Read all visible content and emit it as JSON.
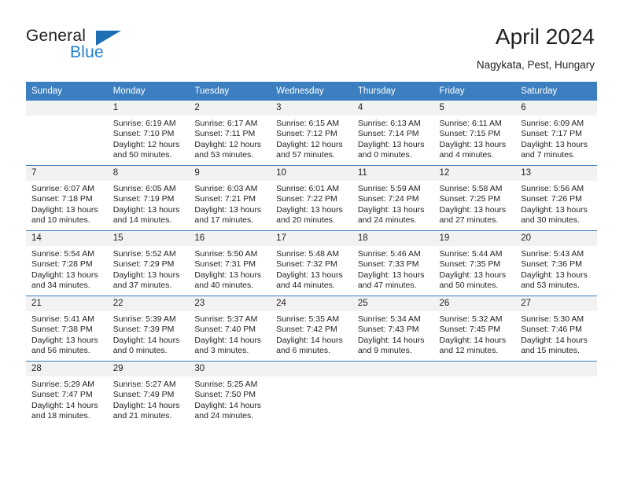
{
  "logo": {
    "word1": "General",
    "word2": "Blue",
    "flag_color": "#1f6fb5",
    "blue_color": "#1f7fd0"
  },
  "header": {
    "month_title": "April 2024",
    "location": "Nagykata, Pest, Hungary"
  },
  "calendar": {
    "header_color": "#3c7fc0",
    "daynum_bg": "#f2f2f2",
    "weekdays": [
      "Sunday",
      "Monday",
      "Tuesday",
      "Wednesday",
      "Thursday",
      "Friday",
      "Saturday"
    ],
    "weeks": [
      [
        {
          "day": "",
          "sunrise": "",
          "sunset": "",
          "daylight1": "",
          "daylight2": ""
        },
        {
          "day": "1",
          "sunrise": "Sunrise: 6:19 AM",
          "sunset": "Sunset: 7:10 PM",
          "daylight1": "Daylight: 12 hours",
          "daylight2": "and 50 minutes."
        },
        {
          "day": "2",
          "sunrise": "Sunrise: 6:17 AM",
          "sunset": "Sunset: 7:11 PM",
          "daylight1": "Daylight: 12 hours",
          "daylight2": "and 53 minutes."
        },
        {
          "day": "3",
          "sunrise": "Sunrise: 6:15 AM",
          "sunset": "Sunset: 7:12 PM",
          "daylight1": "Daylight: 12 hours",
          "daylight2": "and 57 minutes."
        },
        {
          "day": "4",
          "sunrise": "Sunrise: 6:13 AM",
          "sunset": "Sunset: 7:14 PM",
          "daylight1": "Daylight: 13 hours",
          "daylight2": "and 0 minutes."
        },
        {
          "day": "5",
          "sunrise": "Sunrise: 6:11 AM",
          "sunset": "Sunset: 7:15 PM",
          "daylight1": "Daylight: 13 hours",
          "daylight2": "and 4 minutes."
        },
        {
          "day": "6",
          "sunrise": "Sunrise: 6:09 AM",
          "sunset": "Sunset: 7:17 PM",
          "daylight1": "Daylight: 13 hours",
          "daylight2": "and 7 minutes."
        }
      ],
      [
        {
          "day": "7",
          "sunrise": "Sunrise: 6:07 AM",
          "sunset": "Sunset: 7:18 PM",
          "daylight1": "Daylight: 13 hours",
          "daylight2": "and 10 minutes."
        },
        {
          "day": "8",
          "sunrise": "Sunrise: 6:05 AM",
          "sunset": "Sunset: 7:19 PM",
          "daylight1": "Daylight: 13 hours",
          "daylight2": "and 14 minutes."
        },
        {
          "day": "9",
          "sunrise": "Sunrise: 6:03 AM",
          "sunset": "Sunset: 7:21 PM",
          "daylight1": "Daylight: 13 hours",
          "daylight2": "and 17 minutes."
        },
        {
          "day": "10",
          "sunrise": "Sunrise: 6:01 AM",
          "sunset": "Sunset: 7:22 PM",
          "daylight1": "Daylight: 13 hours",
          "daylight2": "and 20 minutes."
        },
        {
          "day": "11",
          "sunrise": "Sunrise: 5:59 AM",
          "sunset": "Sunset: 7:24 PM",
          "daylight1": "Daylight: 13 hours",
          "daylight2": "and 24 minutes."
        },
        {
          "day": "12",
          "sunrise": "Sunrise: 5:58 AM",
          "sunset": "Sunset: 7:25 PM",
          "daylight1": "Daylight: 13 hours",
          "daylight2": "and 27 minutes."
        },
        {
          "day": "13",
          "sunrise": "Sunrise: 5:56 AM",
          "sunset": "Sunset: 7:26 PM",
          "daylight1": "Daylight: 13 hours",
          "daylight2": "and 30 minutes."
        }
      ],
      [
        {
          "day": "14",
          "sunrise": "Sunrise: 5:54 AM",
          "sunset": "Sunset: 7:28 PM",
          "daylight1": "Daylight: 13 hours",
          "daylight2": "and 34 minutes."
        },
        {
          "day": "15",
          "sunrise": "Sunrise: 5:52 AM",
          "sunset": "Sunset: 7:29 PM",
          "daylight1": "Daylight: 13 hours",
          "daylight2": "and 37 minutes."
        },
        {
          "day": "16",
          "sunrise": "Sunrise: 5:50 AM",
          "sunset": "Sunset: 7:31 PM",
          "daylight1": "Daylight: 13 hours",
          "daylight2": "and 40 minutes."
        },
        {
          "day": "17",
          "sunrise": "Sunrise: 5:48 AM",
          "sunset": "Sunset: 7:32 PM",
          "daylight1": "Daylight: 13 hours",
          "daylight2": "and 44 minutes."
        },
        {
          "day": "18",
          "sunrise": "Sunrise: 5:46 AM",
          "sunset": "Sunset: 7:33 PM",
          "daylight1": "Daylight: 13 hours",
          "daylight2": "and 47 minutes."
        },
        {
          "day": "19",
          "sunrise": "Sunrise: 5:44 AM",
          "sunset": "Sunset: 7:35 PM",
          "daylight1": "Daylight: 13 hours",
          "daylight2": "and 50 minutes."
        },
        {
          "day": "20",
          "sunrise": "Sunrise: 5:43 AM",
          "sunset": "Sunset: 7:36 PM",
          "daylight1": "Daylight: 13 hours",
          "daylight2": "and 53 minutes."
        }
      ],
      [
        {
          "day": "21",
          "sunrise": "Sunrise: 5:41 AM",
          "sunset": "Sunset: 7:38 PM",
          "daylight1": "Daylight: 13 hours",
          "daylight2": "and 56 minutes."
        },
        {
          "day": "22",
          "sunrise": "Sunrise: 5:39 AM",
          "sunset": "Sunset: 7:39 PM",
          "daylight1": "Daylight: 14 hours",
          "daylight2": "and 0 minutes."
        },
        {
          "day": "23",
          "sunrise": "Sunrise: 5:37 AM",
          "sunset": "Sunset: 7:40 PM",
          "daylight1": "Daylight: 14 hours",
          "daylight2": "and 3 minutes."
        },
        {
          "day": "24",
          "sunrise": "Sunrise: 5:35 AM",
          "sunset": "Sunset: 7:42 PM",
          "daylight1": "Daylight: 14 hours",
          "daylight2": "and 6 minutes."
        },
        {
          "day": "25",
          "sunrise": "Sunrise: 5:34 AM",
          "sunset": "Sunset: 7:43 PM",
          "daylight1": "Daylight: 14 hours",
          "daylight2": "and 9 minutes."
        },
        {
          "day": "26",
          "sunrise": "Sunrise: 5:32 AM",
          "sunset": "Sunset: 7:45 PM",
          "daylight1": "Daylight: 14 hours",
          "daylight2": "and 12 minutes."
        },
        {
          "day": "27",
          "sunrise": "Sunrise: 5:30 AM",
          "sunset": "Sunset: 7:46 PM",
          "daylight1": "Daylight: 14 hours",
          "daylight2": "and 15 minutes."
        }
      ],
      [
        {
          "day": "28",
          "sunrise": "Sunrise: 5:29 AM",
          "sunset": "Sunset: 7:47 PM",
          "daylight1": "Daylight: 14 hours",
          "daylight2": "and 18 minutes."
        },
        {
          "day": "29",
          "sunrise": "Sunrise: 5:27 AM",
          "sunset": "Sunset: 7:49 PM",
          "daylight1": "Daylight: 14 hours",
          "daylight2": "and 21 minutes."
        },
        {
          "day": "30",
          "sunrise": "Sunrise: 5:25 AM",
          "sunset": "Sunset: 7:50 PM",
          "daylight1": "Daylight: 14 hours",
          "daylight2": "and 24 minutes."
        },
        {
          "day": "",
          "sunrise": "",
          "sunset": "",
          "daylight1": "",
          "daylight2": ""
        },
        {
          "day": "",
          "sunrise": "",
          "sunset": "",
          "daylight1": "",
          "daylight2": ""
        },
        {
          "day": "",
          "sunrise": "",
          "sunset": "",
          "daylight1": "",
          "daylight2": ""
        },
        {
          "day": "",
          "sunrise": "",
          "sunset": "",
          "daylight1": "",
          "daylight2": ""
        }
      ]
    ]
  }
}
